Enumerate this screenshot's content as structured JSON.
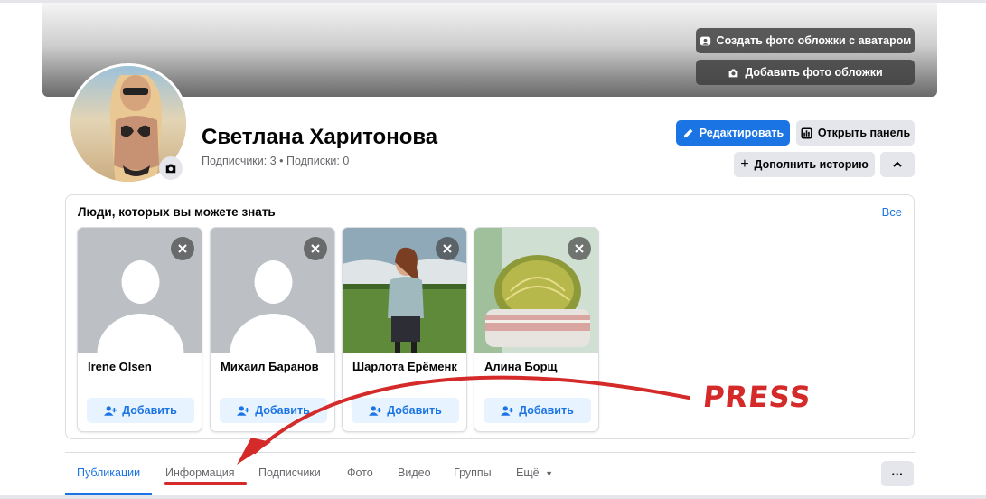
{
  "cover": {
    "avatar_cover_button": "Создать фото обложки с аватаром",
    "add_cover_button": "Добавить фото обложки"
  },
  "profile": {
    "name": "Светлана Харитонова",
    "meta": "Подписчики: 3 • Подписки: 0"
  },
  "actions": {
    "edit": "Редактировать",
    "panel": "Открыть панель",
    "story": "Дополнить историю"
  },
  "pymk": {
    "title": "Люди, которых вы можете знать",
    "see_all": "Все",
    "add_label": "Добавить",
    "people": [
      {
        "name": "Irene Olsen",
        "photo": "default-avatar"
      },
      {
        "name": "Михаил Баранов",
        "photo": "default-avatar"
      },
      {
        "name": "Шарлота Ерёменк",
        "photo": "woman-field"
      },
      {
        "name": "Алина Борщ",
        "photo": "cactus"
      }
    ]
  },
  "tabs": [
    {
      "label": "Публикации",
      "active": true
    },
    {
      "label": "Информация",
      "active": false
    },
    {
      "label": "Подписчики",
      "active": false
    },
    {
      "label": "Фото",
      "active": false
    },
    {
      "label": "Видео",
      "active": false
    },
    {
      "label": "Группы",
      "active": false
    },
    {
      "label": "Ещё",
      "active": false
    }
  ],
  "more_menu": "···",
  "annotation": {
    "text": "PRESS",
    "color": "#d42a2a"
  },
  "colors": {
    "accent": "#1b74e4",
    "secondary_button": "#e4e6eb",
    "text_secondary": "#65676b"
  }
}
